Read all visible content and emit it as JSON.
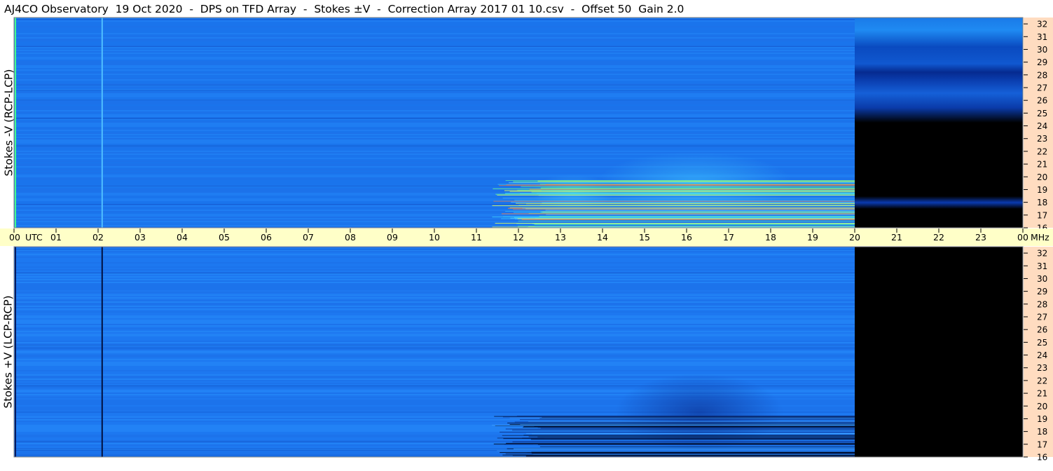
{
  "title": "AJ4CO Observatory  19 Oct 2020  -  DPS on TFD Array  -  Stokes ±V  -  Correction Array 2017 01 10.csv  -  Offset 50  Gain 2.0",
  "colors": {
    "background_blue": "#1e78f0",
    "bright_blue": "#2aa0ff",
    "dark_blue": "#0a3fa8",
    "time_bar": "#ffffc8",
    "freq_axis_bg": "#ffdcc0",
    "no_data": "#000000"
  },
  "chart_data": [
    {
      "type": "heatmap",
      "name": "Stokes -V (RCP-LCP)",
      "ylabel": "Stokes -V (RCP-LCP)",
      "x_hours_utc": [
        "00",
        "01",
        "02",
        "03",
        "04",
        "05",
        "06",
        "07",
        "08",
        "09",
        "10",
        "11",
        "12",
        "13",
        "14",
        "15",
        "16",
        "17",
        "18",
        "19",
        "20",
        "21",
        "22",
        "23",
        "00"
      ],
      "xlim_hours": [
        0,
        24
      ],
      "y_ticks_mhz": [
        "32",
        "31",
        "30",
        "29",
        "28",
        "27",
        "26",
        "25",
        "24",
        "23",
        "22",
        "21",
        "20",
        "19",
        "18",
        "17",
        "16"
      ],
      "ylim_mhz": [
        16,
        32.5
      ],
      "data_end_hour": 20,
      "activity_hours": [
        11,
        20
      ],
      "activity_mhz": [
        16,
        22
      ],
      "no_data_mhz_after_end": [
        [
          18.5,
          24
        ],
        [
          16,
          17.5
        ]
      ]
    },
    {
      "type": "heatmap",
      "name": "Stokes +V (LCP-RCP)",
      "ylabel": "Stokes +V (LCP-RCP)",
      "y_ticks_mhz": [
        "32",
        "31",
        "30",
        "29",
        "28",
        "27",
        "26",
        "25",
        "24",
        "23",
        "22",
        "21",
        "20",
        "19",
        "18",
        "17",
        "16"
      ],
      "ylim_mhz": [
        16,
        32.5
      ],
      "data_end_hour": 20,
      "activity_hours": [
        11,
        20
      ],
      "activity_mhz": [
        16,
        22
      ]
    }
  ],
  "time_axis": {
    "utc_label": "UTC",
    "hours": [
      "00",
      "01",
      "02",
      "03",
      "04",
      "05",
      "06",
      "07",
      "08",
      "09",
      "10",
      "11",
      "12",
      "13",
      "14",
      "15",
      "16",
      "17",
      "18",
      "19",
      "20",
      "21",
      "22",
      "23",
      "00"
    ],
    "unit_label": "MHz"
  }
}
